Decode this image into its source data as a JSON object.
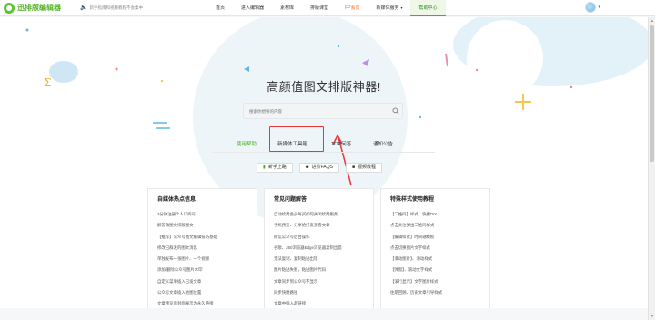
{
  "brand": {
    "name": "迅排版编辑器",
    "accent": "#4cae2c"
  },
  "notice": {
    "icon": "speaker-icon",
    "text": "新手指南和视频教程不会集中"
  },
  "nav": [
    {
      "label": "首页"
    },
    {
      "label": "进入编辑器"
    },
    {
      "label": "素材库"
    },
    {
      "label": "排版课堂"
    },
    {
      "label": "FP会员"
    },
    {
      "label": "新媒体服务"
    },
    {
      "label": "帮助中心"
    }
  ],
  "user": {
    "avatar": "avatar-icon"
  },
  "hero": {
    "headline": "高颜值图文排版神器!",
    "search_placeholder": "搜索你想要的内容"
  },
  "tabs": [
    {
      "label": "使用帮助"
    },
    {
      "label": "新媒体工具箱"
    },
    {
      "label": "TOP问答"
    },
    {
      "label": "通知公告"
    }
  ],
  "buttons": [
    {
      "label": "新手上路",
      "icon": "book-icon"
    },
    {
      "label": "进阶FAQS",
      "icon": "cap-icon"
    },
    {
      "label": "视频教程",
      "icon": "video-icon"
    }
  ],
  "columns": [
    {
      "title": "自媒体热点信息",
      "items": [
        "3分钟注册个人订阅号",
        "解答微图文排版图文",
        "【推荐】公众号图文编辑技巧基础",
        "修改已群发的图文消息",
        "单独发布一张图片、一个视频",
        "添加/删除公众号图片水印",
        "自定义菜单插入已发文章",
        "公众号文章插入地图位置",
        "文章预览后封面展示为永久链接"
      ]
    },
    {
      "title": "常见问题解答",
      "items": [
        "自动续费会员每买如何关闭续费服务",
        "手机预览、分享给好友查看文章",
        "微信公众号后台操作",
        "谷歌、360浏览器Edge浏览器复制出错",
        "无法复制、复制粘贴出错",
        "图片粘贴失败，粘贴图片代码",
        "文章同步到公众号不显示",
        "同步快捷路径",
        "文章中插入超链接"
      ]
    },
    {
      "title": "特殊样式使用教程",
      "items": [
        "【二维码】样式、快捷DIY",
        "点击关注弹出二维码样式",
        "【编辑样式】时间轴模板",
        "点击切换图片文字样式",
        "【滑动图片】、滑动样式",
        "【弹窗】、滚动文字样式",
        "【滚行显示】文字图片样式",
        "往期回顾、历史文章引导样式",
        ""
      ]
    }
  ],
  "colors": {
    "highlight": "#e8363b",
    "hot": "#ff6a00"
  }
}
